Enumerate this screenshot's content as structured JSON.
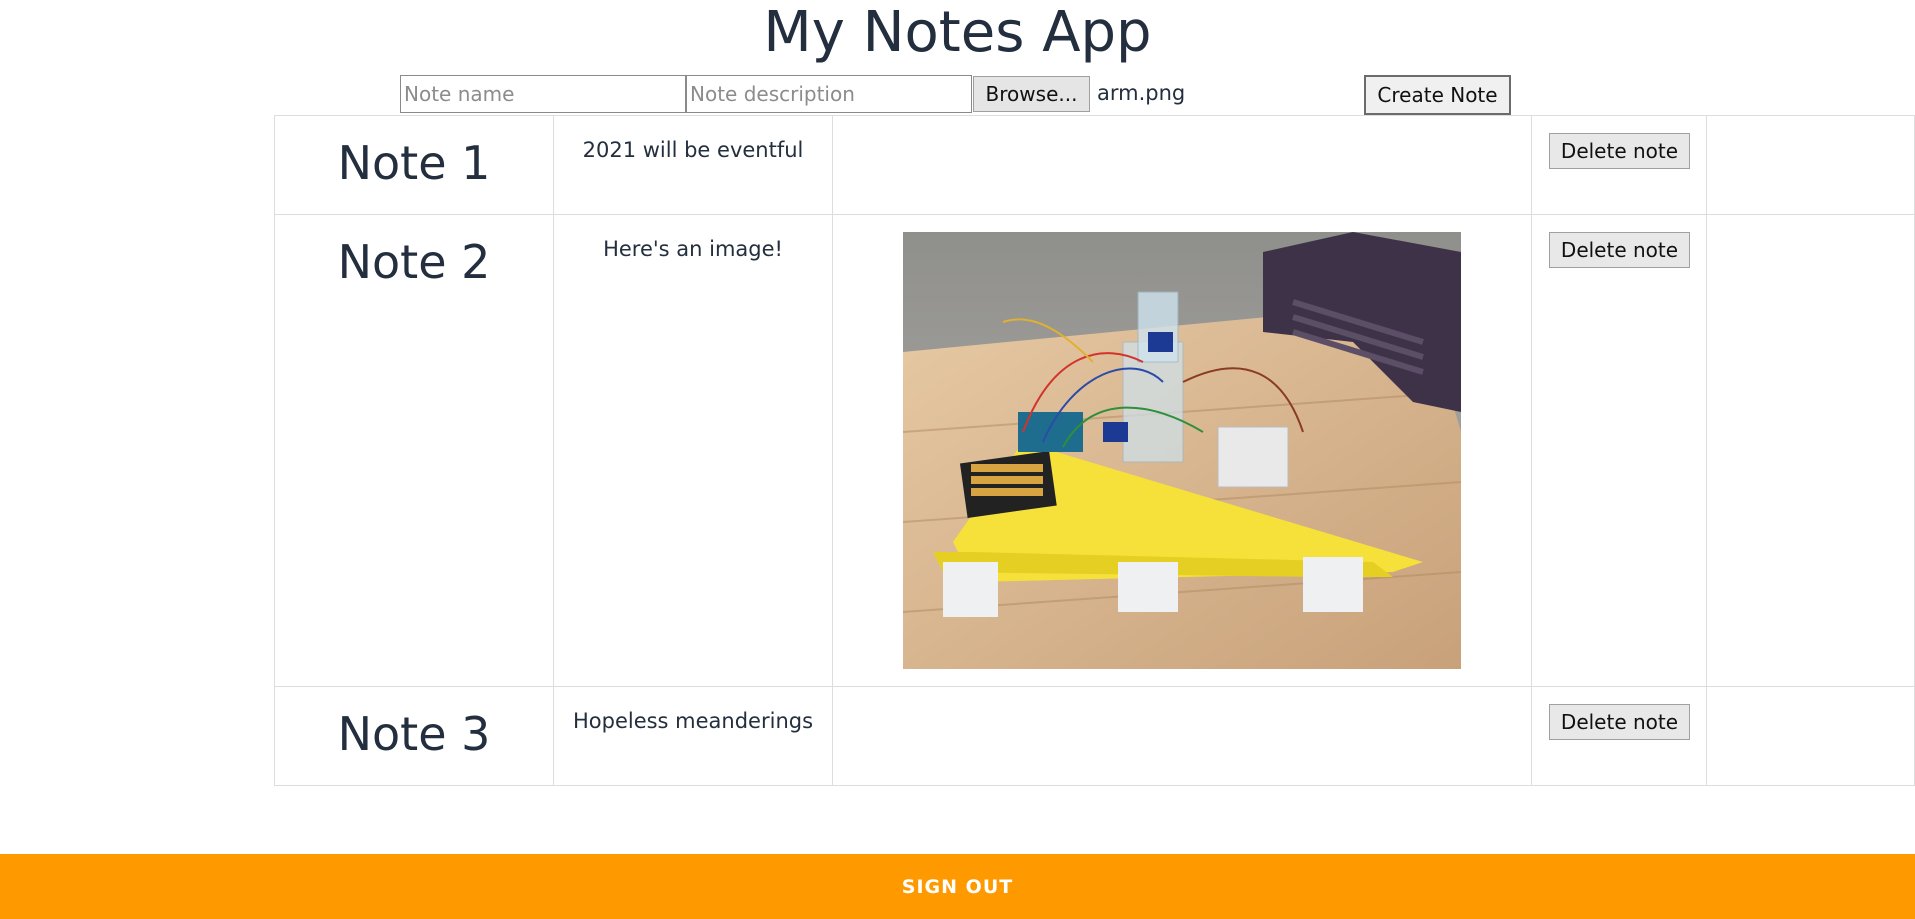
{
  "app": {
    "title": "My Notes App"
  },
  "form": {
    "name_placeholder": "Note name",
    "description_placeholder": "Note description",
    "browse_label": "Browse...",
    "selected_file": "arm.png",
    "create_label": "Create Note"
  },
  "notes": [
    {
      "name": "Note 1",
      "description": "2021 will be eventful",
      "has_image": false,
      "delete_label": "Delete note"
    },
    {
      "name": "Note 2",
      "description": "Here's an image!",
      "has_image": true,
      "image_subject": "robotic-arm-prototype-photo",
      "delete_label": "Delete note"
    },
    {
      "name": "Note 3",
      "description": "Hopeless meanderings",
      "has_image": false,
      "delete_label": "Delete note"
    }
  ],
  "footer": {
    "sign_out_label": "SIGN OUT"
  },
  "colors": {
    "accent": "#ff9900",
    "text": "#232f3e",
    "table_border": "#dddddd"
  }
}
